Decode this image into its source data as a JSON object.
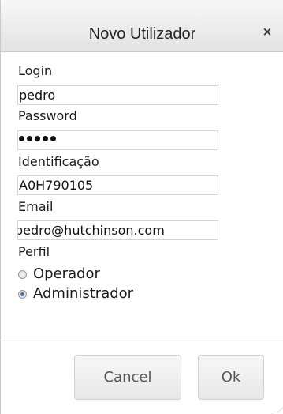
{
  "dialog": {
    "title": "Novo Utilizador",
    "close_icon": "×"
  },
  "form": {
    "login": {
      "label": "Login",
      "value": "pedro"
    },
    "password": {
      "label": "Password",
      "masked_length": 5
    },
    "identificacao": {
      "label": "Identificação",
      "value": "A0H790105"
    },
    "email": {
      "label": "Email",
      "value": "pedro@hutchinson.com"
    },
    "perfil": {
      "label": "Perfil",
      "options": [
        {
          "label": "Operador",
          "selected": false
        },
        {
          "label": "Administrador",
          "selected": true
        }
      ]
    }
  },
  "buttons": {
    "cancel": "Cancel",
    "ok": "Ok"
  },
  "colors": {
    "titlebar": "#e8e8e8",
    "radio_selected": "#4a6fa5",
    "field_border": "#d4d4d4"
  }
}
